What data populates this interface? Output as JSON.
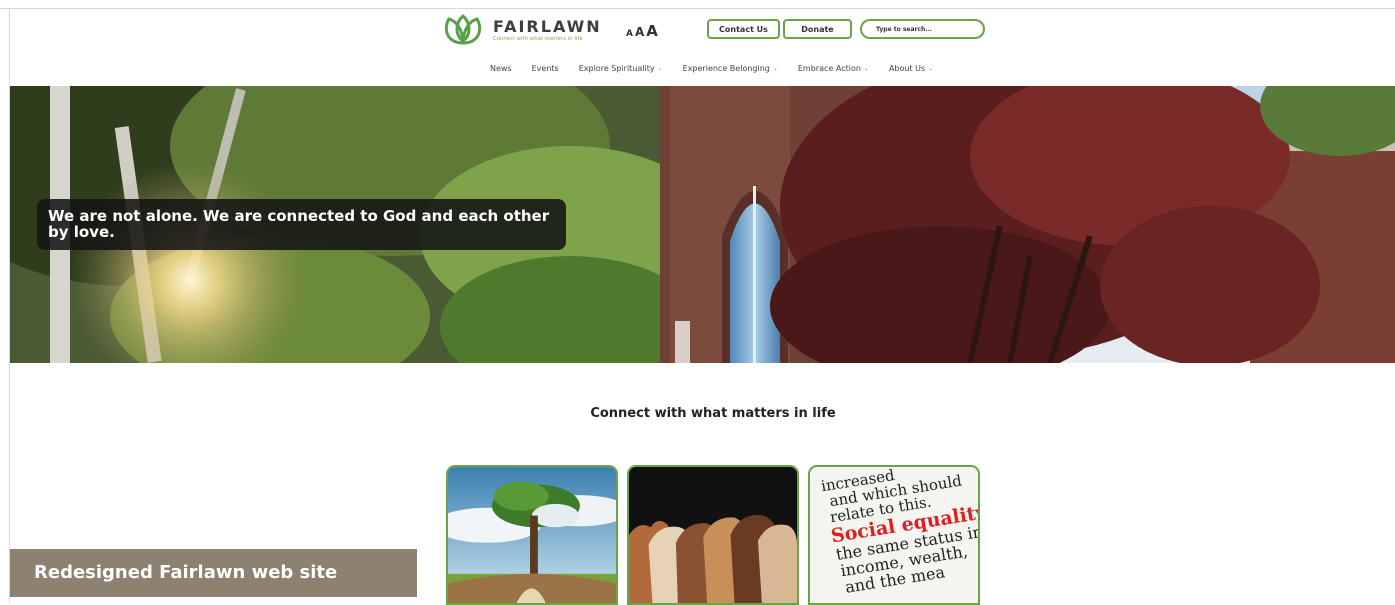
{
  "header": {
    "logo_name": "FAIRLAWN",
    "logo_tagline": "Connect with what matters in life",
    "text_size": [
      "A",
      "A",
      "A"
    ],
    "contact_label": "Contact Us",
    "donate_label": "Donate",
    "search_placeholder": "Type to search..."
  },
  "nav": {
    "items": [
      {
        "label": "News",
        "has_menu": false
      },
      {
        "label": "Events",
        "has_menu": false
      },
      {
        "label": "Explore Spirituality",
        "has_menu": true
      },
      {
        "label": "Experience Belonging",
        "has_menu": true
      },
      {
        "label": "Embrace Action",
        "has_menu": true
      },
      {
        "label": "About Us",
        "has_menu": true
      }
    ]
  },
  "hero": {
    "caption": "We are not alone. We are connected to God and each other by love."
  },
  "main": {
    "tagline": "Connect with what matters in life",
    "card_text": {
      "line1": "increased",
      "line2": "and which should",
      "line3": "relate to this.",
      "line4": "Social equality:",
      "line5": "the same status in",
      "line6": "income, wealth,",
      "line7": "and the mea"
    }
  },
  "caption_ribbon": "Redesigned Fairlawn web site",
  "colors": {
    "accent_green": "#6aa34a",
    "ribbon": "#8d8172",
    "highlight_red": "#e01e1e"
  }
}
